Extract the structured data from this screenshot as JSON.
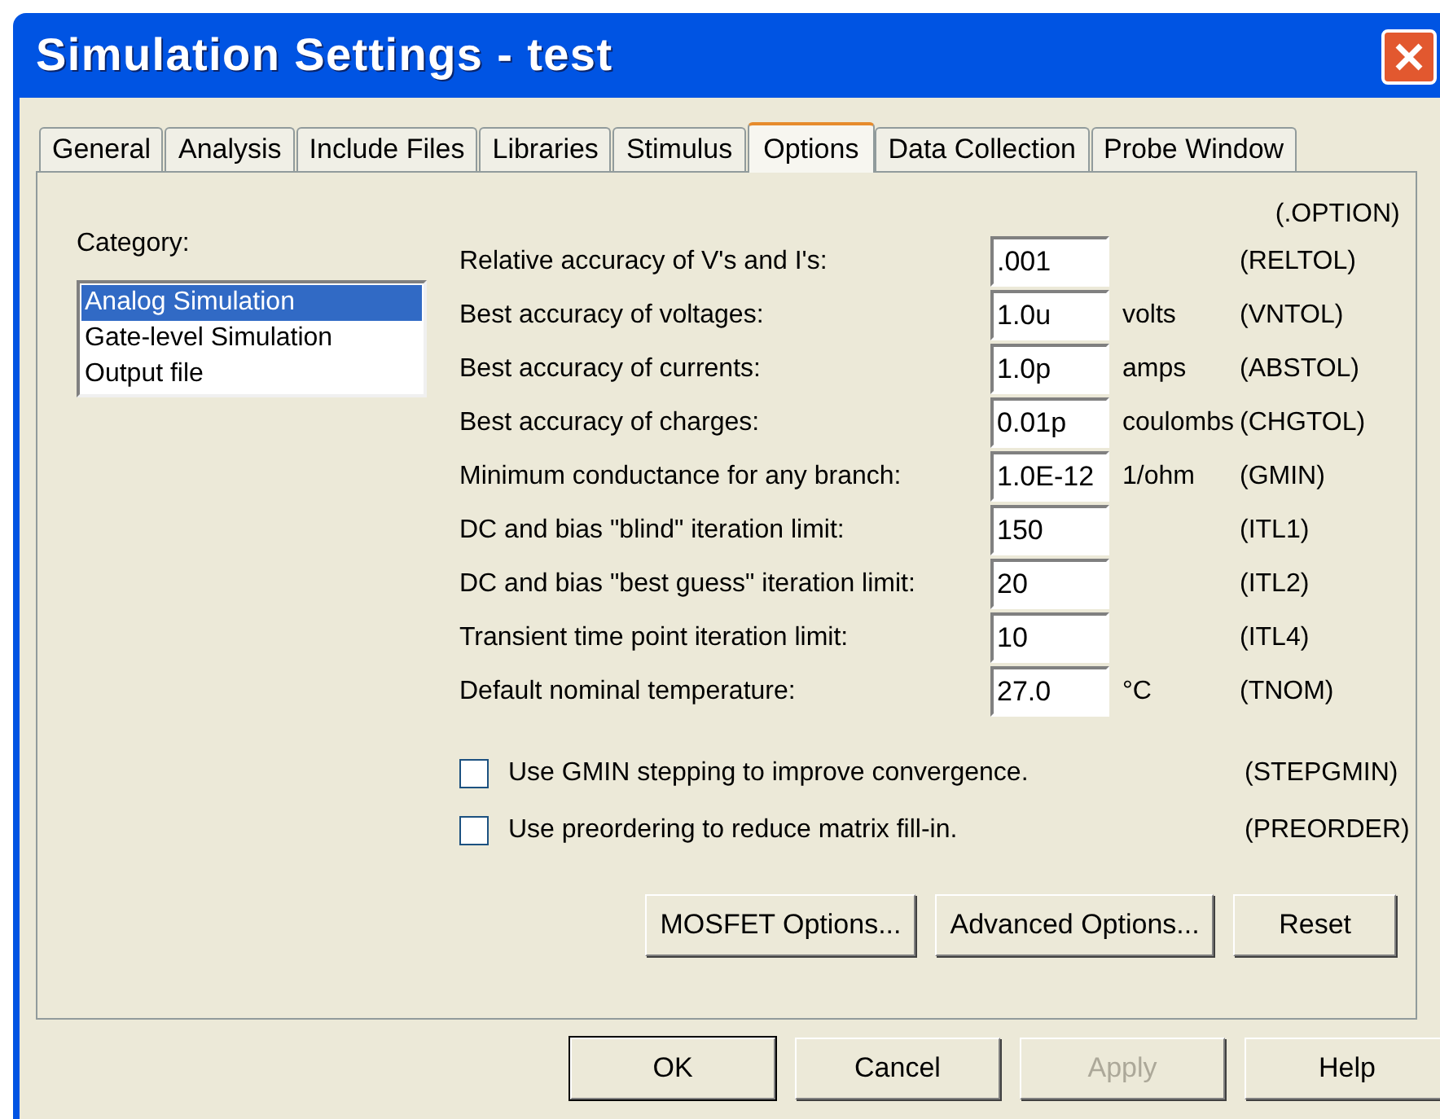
{
  "window": {
    "title": "Simulation Settings - test"
  },
  "tabs": [
    {
      "label": "General",
      "selected": false
    },
    {
      "label": "Analysis",
      "selected": false
    },
    {
      "label": "Include Files",
      "selected": false
    },
    {
      "label": "Libraries",
      "selected": false
    },
    {
      "label": "Stimulus",
      "selected": false
    },
    {
      "label": "Options",
      "selected": true
    },
    {
      "label": "Data Collection",
      "selected": false
    },
    {
      "label": "Probe Window",
      "selected": false
    }
  ],
  "category": {
    "label": "Category:",
    "items": [
      {
        "label": "Analog Simulation",
        "selected": true
      },
      {
        "label": "Gate-level Simulation",
        "selected": false
      },
      {
        "label": "Output file",
        "selected": false
      }
    ]
  },
  "option_header": "(.OPTION)",
  "parameters": [
    {
      "label": "Relative accuracy of V's and I's:",
      "value": ".001",
      "keyword": "(RELTOL)"
    },
    {
      "label": "Best accuracy of voltages:",
      "value": "1.0u",
      "unit": "volts",
      "keyword": "(VNTOL)"
    },
    {
      "label": "Best accuracy of currents:",
      "value": "1.0p",
      "unit": "amps",
      "keyword": "(ABSTOL)"
    },
    {
      "label": "Best accuracy of charges:",
      "value": "0.01p",
      "unit": "coulombs",
      "keyword": "(CHGTOL)"
    },
    {
      "label": "Minimum conductance for any branch:",
      "value": "1.0E-12",
      "unit": "1/ohm",
      "keyword": "(GMIN)"
    },
    {
      "label": "DC and bias \"blind\" iteration limit:",
      "value": "150",
      "keyword": "(ITL1)"
    },
    {
      "label": "DC and bias \"best guess\" iteration limit:",
      "value": "20",
      "keyword": "(ITL2)"
    },
    {
      "label": "Transient time point iteration limit:",
      "value": "10",
      "keyword": "(ITL4)"
    },
    {
      "label": "Default nominal temperature:",
      "value": "27.0",
      "unit": "°C",
      "keyword": "(TNOM)"
    }
  ],
  "checkboxes": [
    {
      "label": "Use GMIN stepping to improve convergence.",
      "checked": false,
      "keyword": "(STEPGMIN)"
    },
    {
      "label": "Use preordering to reduce matrix fill-in.",
      "checked": false,
      "keyword": "(PREORDER)"
    }
  ],
  "panel_buttons": [
    {
      "label": "MOSFET Options..."
    },
    {
      "label": "Advanced Options..."
    },
    {
      "label": "Reset"
    }
  ],
  "dialog_buttons": [
    {
      "label": "OK",
      "default": true,
      "disabled": false
    },
    {
      "label": "Cancel",
      "default": false,
      "disabled": false
    },
    {
      "label": "Apply",
      "default": false,
      "disabled": true
    },
    {
      "label": "Help",
      "default": false,
      "disabled": false
    }
  ]
}
